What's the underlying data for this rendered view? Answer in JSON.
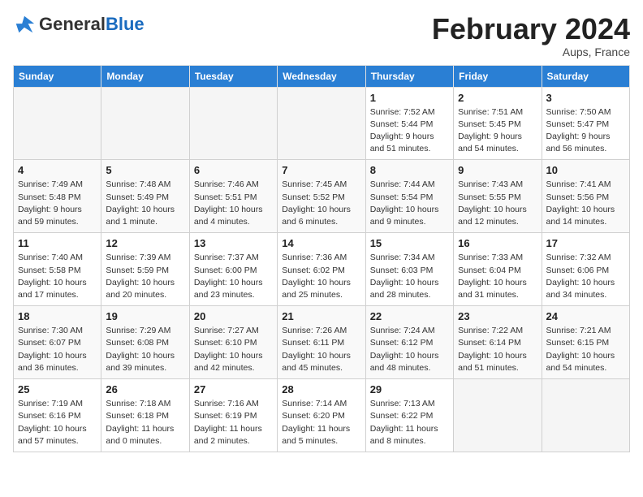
{
  "header": {
    "logo_general": "General",
    "logo_blue": "Blue",
    "month_title": "February 2024",
    "location": "Aups, France"
  },
  "columns": [
    "Sunday",
    "Monday",
    "Tuesday",
    "Wednesday",
    "Thursday",
    "Friday",
    "Saturday"
  ],
  "weeks": [
    [
      {
        "day": "",
        "info": ""
      },
      {
        "day": "",
        "info": ""
      },
      {
        "day": "",
        "info": ""
      },
      {
        "day": "",
        "info": ""
      },
      {
        "day": "1",
        "info": "Sunrise: 7:52 AM\nSunset: 5:44 PM\nDaylight: 9 hours\nand 51 minutes."
      },
      {
        "day": "2",
        "info": "Sunrise: 7:51 AM\nSunset: 5:45 PM\nDaylight: 9 hours\nand 54 minutes."
      },
      {
        "day": "3",
        "info": "Sunrise: 7:50 AM\nSunset: 5:47 PM\nDaylight: 9 hours\nand 56 minutes."
      }
    ],
    [
      {
        "day": "4",
        "info": "Sunrise: 7:49 AM\nSunset: 5:48 PM\nDaylight: 9 hours\nand 59 minutes."
      },
      {
        "day": "5",
        "info": "Sunrise: 7:48 AM\nSunset: 5:49 PM\nDaylight: 10 hours\nand 1 minute."
      },
      {
        "day": "6",
        "info": "Sunrise: 7:46 AM\nSunset: 5:51 PM\nDaylight: 10 hours\nand 4 minutes."
      },
      {
        "day": "7",
        "info": "Sunrise: 7:45 AM\nSunset: 5:52 PM\nDaylight: 10 hours\nand 6 minutes."
      },
      {
        "day": "8",
        "info": "Sunrise: 7:44 AM\nSunset: 5:54 PM\nDaylight: 10 hours\nand 9 minutes."
      },
      {
        "day": "9",
        "info": "Sunrise: 7:43 AM\nSunset: 5:55 PM\nDaylight: 10 hours\nand 12 minutes."
      },
      {
        "day": "10",
        "info": "Sunrise: 7:41 AM\nSunset: 5:56 PM\nDaylight: 10 hours\nand 14 minutes."
      }
    ],
    [
      {
        "day": "11",
        "info": "Sunrise: 7:40 AM\nSunset: 5:58 PM\nDaylight: 10 hours\nand 17 minutes."
      },
      {
        "day": "12",
        "info": "Sunrise: 7:39 AM\nSunset: 5:59 PM\nDaylight: 10 hours\nand 20 minutes."
      },
      {
        "day": "13",
        "info": "Sunrise: 7:37 AM\nSunset: 6:00 PM\nDaylight: 10 hours\nand 23 minutes."
      },
      {
        "day": "14",
        "info": "Sunrise: 7:36 AM\nSunset: 6:02 PM\nDaylight: 10 hours\nand 25 minutes."
      },
      {
        "day": "15",
        "info": "Sunrise: 7:34 AM\nSunset: 6:03 PM\nDaylight: 10 hours\nand 28 minutes."
      },
      {
        "day": "16",
        "info": "Sunrise: 7:33 AM\nSunset: 6:04 PM\nDaylight: 10 hours\nand 31 minutes."
      },
      {
        "day": "17",
        "info": "Sunrise: 7:32 AM\nSunset: 6:06 PM\nDaylight: 10 hours\nand 34 minutes."
      }
    ],
    [
      {
        "day": "18",
        "info": "Sunrise: 7:30 AM\nSunset: 6:07 PM\nDaylight: 10 hours\nand 36 minutes."
      },
      {
        "day": "19",
        "info": "Sunrise: 7:29 AM\nSunset: 6:08 PM\nDaylight: 10 hours\nand 39 minutes."
      },
      {
        "day": "20",
        "info": "Sunrise: 7:27 AM\nSunset: 6:10 PM\nDaylight: 10 hours\nand 42 minutes."
      },
      {
        "day": "21",
        "info": "Sunrise: 7:26 AM\nSunset: 6:11 PM\nDaylight: 10 hours\nand 45 minutes."
      },
      {
        "day": "22",
        "info": "Sunrise: 7:24 AM\nSunset: 6:12 PM\nDaylight: 10 hours\nand 48 minutes."
      },
      {
        "day": "23",
        "info": "Sunrise: 7:22 AM\nSunset: 6:14 PM\nDaylight: 10 hours\nand 51 minutes."
      },
      {
        "day": "24",
        "info": "Sunrise: 7:21 AM\nSunset: 6:15 PM\nDaylight: 10 hours\nand 54 minutes."
      }
    ],
    [
      {
        "day": "25",
        "info": "Sunrise: 7:19 AM\nSunset: 6:16 PM\nDaylight: 10 hours\nand 57 minutes."
      },
      {
        "day": "26",
        "info": "Sunrise: 7:18 AM\nSunset: 6:18 PM\nDaylight: 11 hours\nand 0 minutes."
      },
      {
        "day": "27",
        "info": "Sunrise: 7:16 AM\nSunset: 6:19 PM\nDaylight: 11 hours\nand 2 minutes."
      },
      {
        "day": "28",
        "info": "Sunrise: 7:14 AM\nSunset: 6:20 PM\nDaylight: 11 hours\nand 5 minutes."
      },
      {
        "day": "29",
        "info": "Sunrise: 7:13 AM\nSunset: 6:22 PM\nDaylight: 11 hours\nand 8 minutes."
      },
      {
        "day": "",
        "info": ""
      },
      {
        "day": "",
        "info": ""
      }
    ]
  ]
}
